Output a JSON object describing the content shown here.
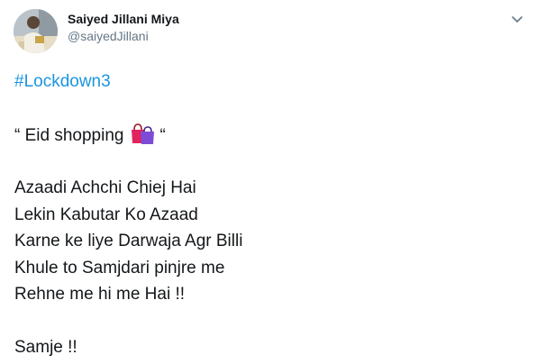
{
  "author": {
    "display_name": "Saiyed Jillani Miya",
    "handle": "@saiyedJillani"
  },
  "icons": {
    "avatar": "avatar-photo",
    "menu": "chevron-down-icon",
    "emoji": "shopping-bags-icon"
  },
  "colors": {
    "hashtag": "#1b95e0",
    "handle": "#657786",
    "text": "#14171a"
  },
  "tweet": {
    "hashtag": "#Lockdown3",
    "quote_open": "“ Eid shopping",
    "quote_close": "“",
    "lines": [
      "Azaadi Achchi Chiej Hai",
      "Lekin Kabutar Ko Azaad",
      "Karne ke liye Darwaja Agr Billi",
      "Khule to Samjdari pinjre me",
      "Rehne me hi me Hai  !!"
    ],
    "closing": "Samje !!"
  }
}
